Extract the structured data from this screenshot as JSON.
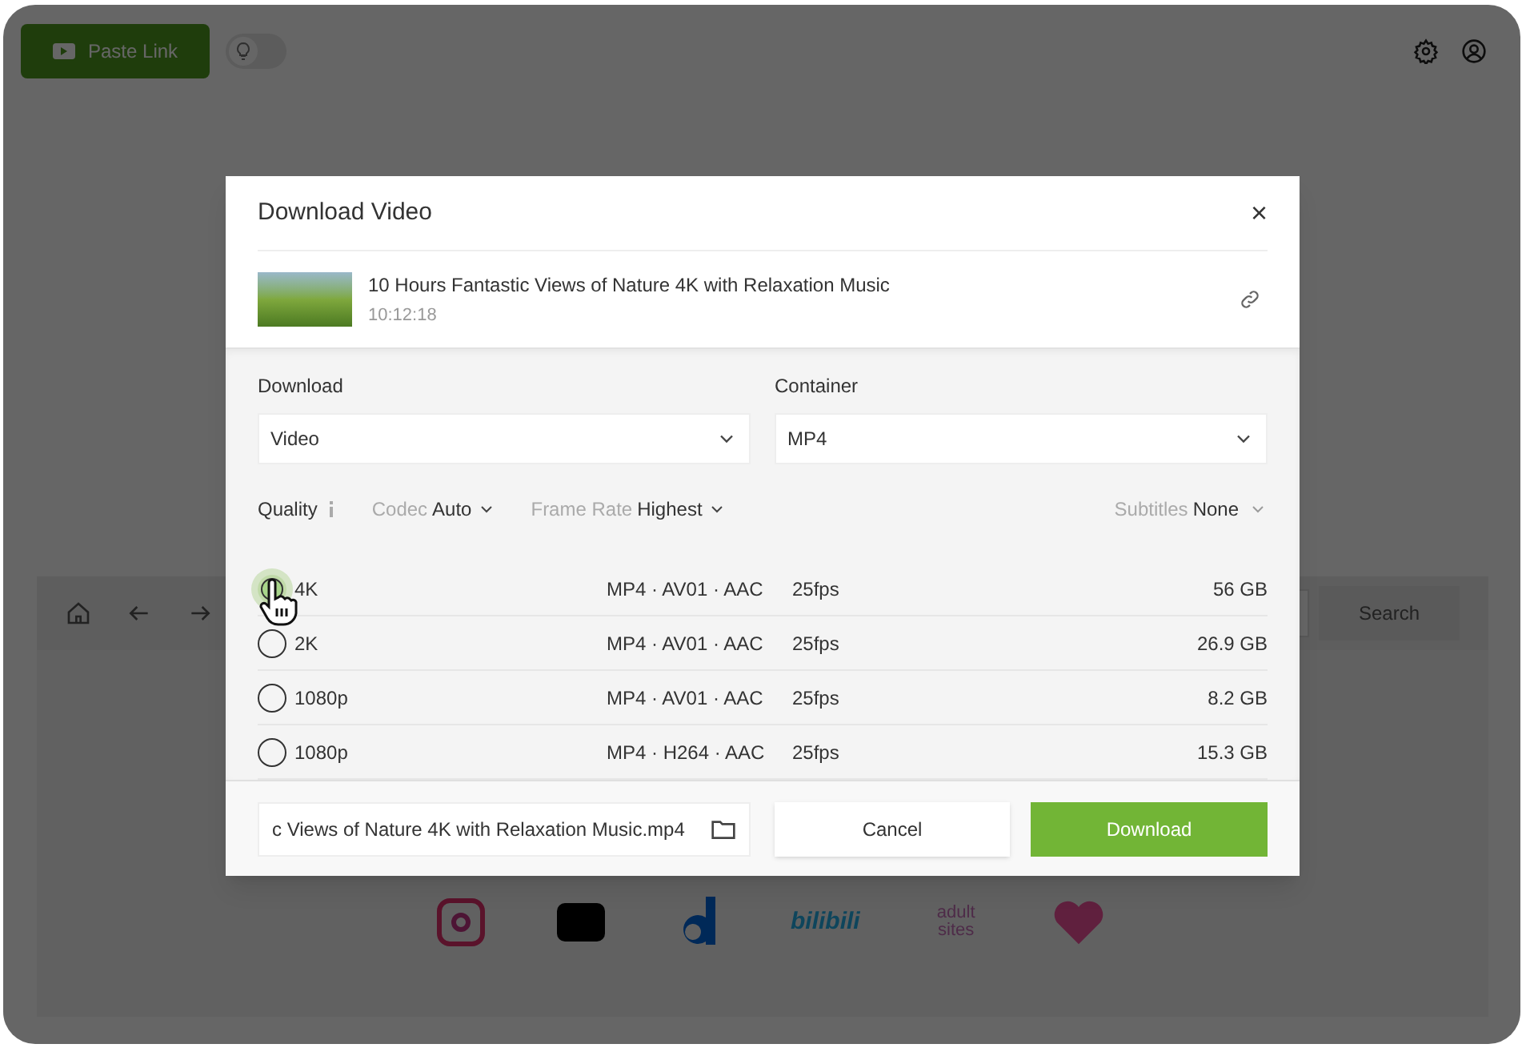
{
  "toolbar": {
    "paste_button": "Paste Link",
    "light_toggle": {
      "on": false
    }
  },
  "browser": {
    "search_button": "Search",
    "sites": [
      {
        "kind": "instagram"
      },
      {
        "kind": "tv"
      },
      {
        "kind": "dailymotion"
      },
      {
        "kind": "bilibili",
        "label": "bilibili"
      },
      {
        "kind": "adult",
        "label": "adult sites"
      },
      {
        "kind": "heart"
      }
    ]
  },
  "dialog": {
    "title": "Download Video",
    "close": "×",
    "video": {
      "title": "10 Hours Fantastic Views of Nature 4K with Relaxation Music",
      "duration": "10:12:18"
    },
    "download": {
      "label": "Download",
      "value": "Video"
    },
    "container": {
      "label": "Container",
      "value": "MP4"
    },
    "quality_label": "Quality",
    "filters": [
      {
        "label": "Codec",
        "value": "Auto"
      },
      {
        "label": "Frame Rate",
        "value": "Highest"
      }
    ],
    "subtitles": {
      "label": "Subtitles",
      "value": "None"
    },
    "formats": [
      {
        "quality": "4K",
        "format": "MP4 · AV01 · AAC",
        "fps": "25fps",
        "size": "56 GB",
        "selected": true
      },
      {
        "quality": "2K",
        "format": "MP4 · AV01 · AAC",
        "fps": "25fps",
        "size": "26.9 GB",
        "selected": false
      },
      {
        "quality": "1080p",
        "format": "MP4 · AV01 · AAC",
        "fps": "25fps",
        "size": "8.2 GB",
        "selected": false
      },
      {
        "quality": "1080p",
        "format": "MP4 · H264 · AAC",
        "fps": "25fps",
        "size": "15.3 GB",
        "selected": false
      }
    ],
    "filename": "c Views of Nature 4K with Relaxation Music.mp4",
    "cancel_button": "Cancel",
    "download_button": "Download"
  }
}
